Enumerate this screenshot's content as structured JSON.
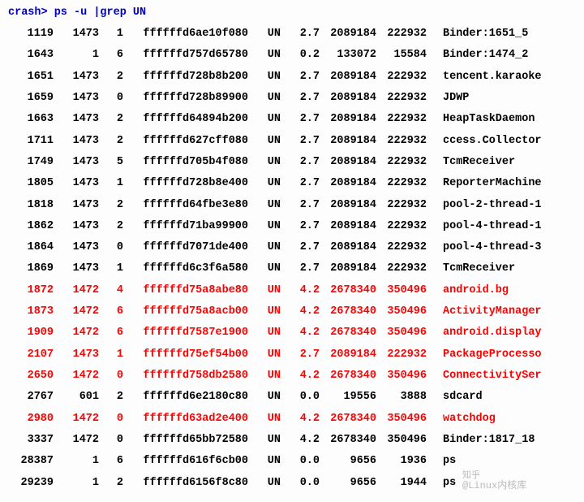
{
  "prompt": {
    "part1": "crash>",
    "part2": " ps -u |grep UN"
  },
  "watermark": {
    "line1": "知乎",
    "line2": "@Linux内核库"
  },
  "rows": [
    {
      "pid": "1119",
      "ppid": "1473",
      "n": "1",
      "addr": "ffffffd6ae10f080",
      "state": "UN",
      "pct": "2.7",
      "sz1": "2089184",
      "sz2": "222932",
      "name": "Binder:1651_5",
      "red": false
    },
    {
      "pid": "1643",
      "ppid": "1",
      "n": "6",
      "addr": "ffffffd757d65780",
      "state": "UN",
      "pct": "0.2",
      "sz1": "133072",
      "sz2": "15584",
      "name": "Binder:1474_2",
      "red": false
    },
    {
      "pid": "1651",
      "ppid": "1473",
      "n": "2",
      "addr": "ffffffd728b8b200",
      "state": "UN",
      "pct": "2.7",
      "sz1": "2089184",
      "sz2": "222932",
      "name": "tencent.karaoke",
      "red": false
    },
    {
      "pid": "1659",
      "ppid": "1473",
      "n": "0",
      "addr": "ffffffd728b89900",
      "state": "UN",
      "pct": "2.7",
      "sz1": "2089184",
      "sz2": "222932",
      "name": "JDWP",
      "red": false
    },
    {
      "pid": "1663",
      "ppid": "1473",
      "n": "2",
      "addr": "ffffffd64894b200",
      "state": "UN",
      "pct": "2.7",
      "sz1": "2089184",
      "sz2": "222932",
      "name": "HeapTaskDaemon",
      "red": false
    },
    {
      "pid": "1711",
      "ppid": "1473",
      "n": "2",
      "addr": "ffffffd627cff080",
      "state": "UN",
      "pct": "2.7",
      "sz1": "2089184",
      "sz2": "222932",
      "name": "ccess.Collector",
      "red": false
    },
    {
      "pid": "1749",
      "ppid": "1473",
      "n": "5",
      "addr": "ffffffd705b4f080",
      "state": "UN",
      "pct": "2.7",
      "sz1": "2089184",
      "sz2": "222932",
      "name": "TcmReceiver",
      "red": false
    },
    {
      "pid": "1805",
      "ppid": "1473",
      "n": "1",
      "addr": "ffffffd728b8e400",
      "state": "UN",
      "pct": "2.7",
      "sz1": "2089184",
      "sz2": "222932",
      "name": "ReporterMachine",
      "red": false
    },
    {
      "pid": "1818",
      "ppid": "1473",
      "n": "2",
      "addr": "ffffffd64fbe3e80",
      "state": "UN",
      "pct": "2.7",
      "sz1": "2089184",
      "sz2": "222932",
      "name": "pool-2-thread-1",
      "red": false
    },
    {
      "pid": "1862",
      "ppid": "1473",
      "n": "2",
      "addr": "ffffffd71ba99900",
      "state": "UN",
      "pct": "2.7",
      "sz1": "2089184",
      "sz2": "222932",
      "name": "pool-4-thread-1",
      "red": false
    },
    {
      "pid": "1864",
      "ppid": "1473",
      "n": "0",
      "addr": "ffffffd7071de400",
      "state": "UN",
      "pct": "2.7",
      "sz1": "2089184",
      "sz2": "222932",
      "name": "pool-4-thread-3",
      "red": false
    },
    {
      "pid": "1869",
      "ppid": "1473",
      "n": "1",
      "addr": "ffffffd6c3f6a580",
      "state": "UN",
      "pct": "2.7",
      "sz1": "2089184",
      "sz2": "222932",
      "name": "TcmReceiver",
      "red": false
    },
    {
      "pid": "1872",
      "ppid": "1472",
      "n": "4",
      "addr": "ffffffd75a8abe80",
      "state": "UN",
      "pct": "4.2",
      "sz1": "2678340",
      "sz2": "350496",
      "name": "android.bg",
      "red": true
    },
    {
      "pid": "1873",
      "ppid": "1472",
      "n": "6",
      "addr": "ffffffd75a8acb00",
      "state": "UN",
      "pct": "4.2",
      "sz1": "2678340",
      "sz2": "350496",
      "name": "ActivityManager",
      "red": true
    },
    {
      "pid": "1909",
      "ppid": "1472",
      "n": "6",
      "addr": "ffffffd7587e1900",
      "state": "UN",
      "pct": "4.2",
      "sz1": "2678340",
      "sz2": "350496",
      "name": "android.display",
      "red": true
    },
    {
      "pid": "2107",
      "ppid": "1473",
      "n": "1",
      "addr": "ffffffd75ef54b00",
      "state": "UN",
      "pct": "2.7",
      "sz1": "2089184",
      "sz2": "222932",
      "name": "PackageProcesso",
      "red": true
    },
    {
      "pid": "2650",
      "ppid": "1472",
      "n": "0",
      "addr": "ffffffd758db2580",
      "state": "UN",
      "pct": "4.2",
      "sz1": "2678340",
      "sz2": "350496",
      "name": "ConnectivitySer",
      "red": true
    },
    {
      "pid": "2767",
      "ppid": "601",
      "n": "2",
      "addr": "ffffffd6e2180c80",
      "state": "UN",
      "pct": "0.0",
      "sz1": "19556",
      "sz2": "3888",
      "name": "sdcard",
      "red": false
    },
    {
      "pid": "2980",
      "ppid": "1472",
      "n": "0",
      "addr": "ffffffd63ad2e400",
      "state": "UN",
      "pct": "4.2",
      "sz1": "2678340",
      "sz2": "350496",
      "name": "watchdog",
      "red": true
    },
    {
      "pid": "3337",
      "ppid": "1472",
      "n": "0",
      "addr": "ffffffd65bb72580",
      "state": "UN",
      "pct": "4.2",
      "sz1": "2678340",
      "sz2": "350496",
      "name": "Binder:1817_18",
      "red": false
    },
    {
      "pid": "28387",
      "ppid": "1",
      "n": "6",
      "addr": "ffffffd616f6cb00",
      "state": "UN",
      "pct": "0.0",
      "sz1": "9656",
      "sz2": "1936",
      "name": "ps",
      "red": false
    },
    {
      "pid": "29239",
      "ppid": "1",
      "n": "2",
      "addr": "ffffffd6156f8c80",
      "state": "UN",
      "pct": "0.0",
      "sz1": "9656",
      "sz2": "1944",
      "name": "ps",
      "red": false
    }
  ]
}
